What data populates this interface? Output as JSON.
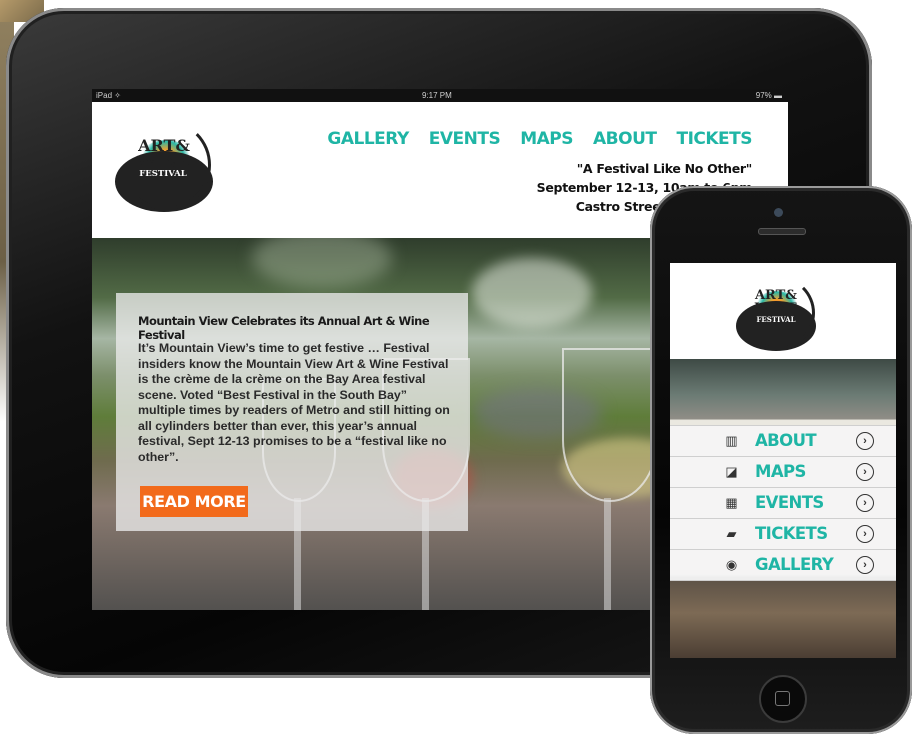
{
  "status_bar": {
    "carrier": "iPad ✧",
    "time": "9:17 PM",
    "battery": "97% ▬"
  },
  "logo": {
    "line1": "ART&",
    "line2": "WINE",
    "line3": "FESTIVAL"
  },
  "nav": [
    "GALLERY",
    "EVENTS",
    "MAPS",
    "ABOUT",
    "TICKETS"
  ],
  "tagline": {
    "quote": "\"A Festival Like No Other\"",
    "dates": "September 12-13,  10am to 6pm",
    "location": "Castro Street, Mountain V"
  },
  "feature": {
    "title": "Mountain View Celebrates its Annual Art & Wine Festival",
    "body": "It’s Mountain View’s time to get festive … Festival insiders know the Mountain View Art & Wine Festival is the crème de la crème on the Bay Area festival scene. Voted “Best Festival in the South Bay” multiple times by readers of Metro and still hitting on all cylinders better than ever, this year’s annual festival, Sept 12-13 promises to be a “festival like no other”.",
    "button": "READ MORE"
  },
  "phone_menu": [
    {
      "label": "ABOUT",
      "icon": "book-icon",
      "glyph": "▥"
    },
    {
      "label": "MAPS",
      "icon": "map-icon",
      "glyph": "◪"
    },
    {
      "label": "EVENTS",
      "icon": "calendar-icon",
      "glyph": "▦"
    },
    {
      "label": "TICKETS",
      "icon": "ticket-icon",
      "glyph": "▰"
    },
    {
      "label": "GALLERY",
      "icon": "camera-icon",
      "glyph": "◉"
    }
  ],
  "colors": {
    "accent": "#1fb5a5",
    "button": "#f26a1b",
    "text": "#111111"
  }
}
